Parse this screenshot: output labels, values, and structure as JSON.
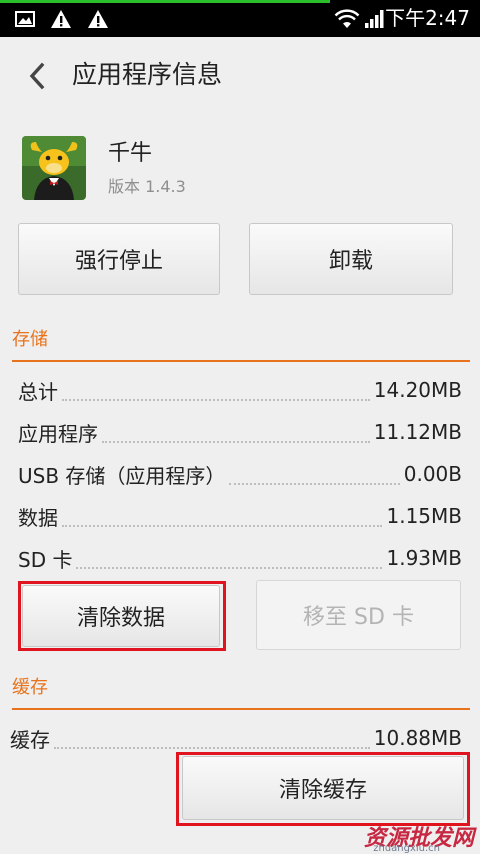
{
  "status_bar": {
    "time": "下午2:47",
    "left_icons": [
      "image-notification-icon",
      "warning-icon",
      "warning-icon"
    ],
    "right_icons": [
      "wifi-icon",
      "signal-icon"
    ]
  },
  "header": {
    "title": "应用程序信息"
  },
  "app": {
    "name": "千牛",
    "version": "版本 1.4.3"
  },
  "actions": {
    "force_stop": "强行停止",
    "uninstall": "卸载"
  },
  "storage": {
    "title": "存储",
    "rows": [
      {
        "label": "总计",
        "value": "14.20MB"
      },
      {
        "label": "应用程序",
        "value": "11.12MB"
      },
      {
        "label": "USB 存储（应用程序）",
        "value": "0.00B"
      },
      {
        "label": "数据",
        "value": "1.15MB"
      },
      {
        "label": "SD 卡",
        "value": "1.93MB"
      }
    ],
    "clear_data": "清除数据",
    "move_to_sd": "移至 SD 卡"
  },
  "cache": {
    "title": "缓存",
    "rows": [
      {
        "label": "缓存",
        "value": "10.88MB"
      }
    ],
    "clear_cache": "清除缓存"
  },
  "watermark": {
    "text": "资源批发网",
    "domain": "zhuangxiu.cn"
  },
  "colors": {
    "accent": "#e8731c",
    "highlight": "#e0141e",
    "status_bar": "#000000"
  }
}
